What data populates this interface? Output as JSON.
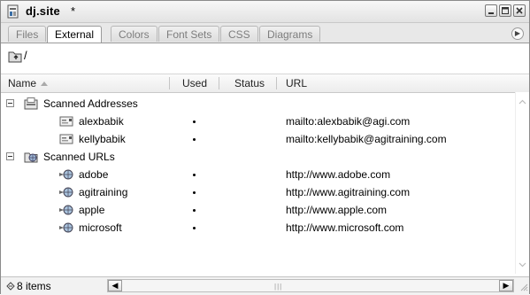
{
  "window": {
    "title": "dj.site",
    "dirty_marker": "*"
  },
  "tabs": [
    {
      "label": "Files",
      "active": false
    },
    {
      "label": "External",
      "active": true
    },
    {
      "label": "Colors",
      "active": false
    },
    {
      "label": "Font Sets",
      "active": false
    },
    {
      "label": "CSS",
      "active": false
    },
    {
      "label": "Diagrams",
      "active": false
    }
  ],
  "toolbar": {
    "path_label": "/"
  },
  "columns": {
    "name": "Name",
    "used": "Used",
    "status": "Status",
    "url": "URL"
  },
  "tree": {
    "groups": [
      {
        "label": "Scanned Addresses",
        "expanded": true,
        "icon": "address-book-icon",
        "items": [
          {
            "name": "alexbabik",
            "used": true,
            "status": "",
            "url": "mailto:alexbabik@agi.com",
            "icon": "email-address-icon"
          },
          {
            "name": "kellybabik",
            "used": true,
            "status": "",
            "url": "mailto:kellybabik@agitraining.com",
            "icon": "email-address-icon"
          }
        ]
      },
      {
        "label": "Scanned URLs",
        "expanded": true,
        "icon": "globe-folder-icon",
        "items": [
          {
            "name": "adobe",
            "used": true,
            "status": "",
            "url": "http://www.adobe.com",
            "icon": "web-link-icon"
          },
          {
            "name": "agitraining",
            "used": true,
            "status": "",
            "url": "http://www.agitraining.com",
            "icon": "web-link-icon"
          },
          {
            "name": "apple",
            "used": true,
            "status": "",
            "url": "http://www.apple.com",
            "icon": "web-link-icon"
          },
          {
            "name": "microsoft",
            "used": true,
            "status": "",
            "url": "http://www.microsoft.com",
            "icon": "web-link-icon"
          }
        ]
      }
    ]
  },
  "status": {
    "items_count": "8 items"
  },
  "colors": {
    "tab_inactive_text": "#7d7d7d",
    "header_bg": "#ececec"
  }
}
